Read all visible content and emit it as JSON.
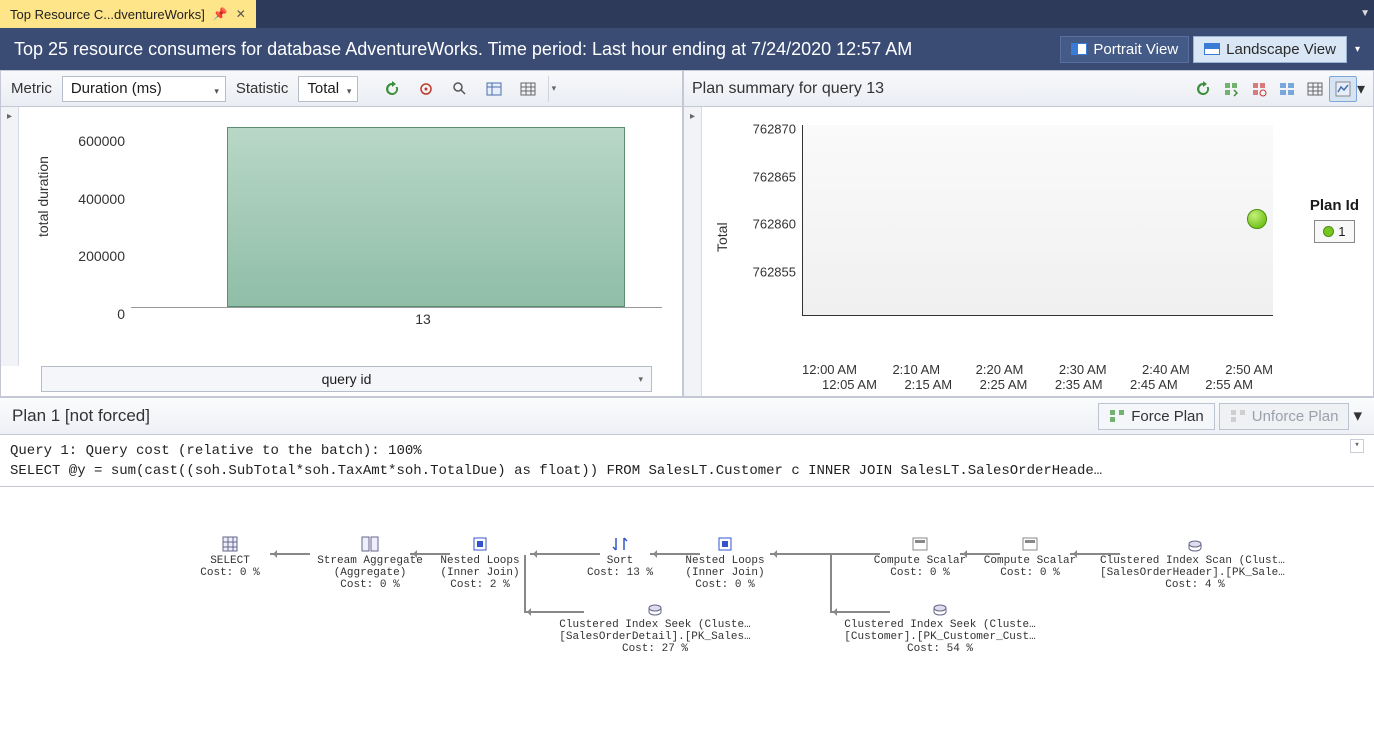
{
  "tab": {
    "title": "Top Resource C...dventureWorks]"
  },
  "header": {
    "title": "Top 25 resource consumers for database AdventureWorks. Time period: Last hour ending at 7/24/2020 12:57 AM",
    "portrait": "Portrait View",
    "landscape": "Landscape View"
  },
  "left_toolbar": {
    "metric_label": "Metric",
    "metric_value": "Duration (ms)",
    "statistic_label": "Statistic",
    "statistic_value": "Total"
  },
  "right_header": {
    "title": "Plan summary for query 13"
  },
  "left_chart": {
    "ylabel": "total duration",
    "yticks": [
      "600000",
      "400000",
      "200000",
      "0"
    ],
    "xitem": "13",
    "xlabel_dropdown": "query id"
  },
  "right_chart": {
    "ylabel": "Total",
    "yticks": [
      "762870",
      "762865",
      "762860",
      "762855"
    ],
    "xticks_top": [
      "12:00 AM",
      "2:10 AM",
      "2:20 AM",
      "2:30 AM",
      "2:40 AM",
      "2:50 AM"
    ],
    "xticks_bot": [
      "12:05 AM",
      "2:15 AM",
      "2:25 AM",
      "2:35 AM",
      "2:45 AM",
      "2:55 AM"
    ],
    "legend_title": "Plan Id",
    "legend_value": "1"
  },
  "plan_bar": {
    "title": "Plan 1 [not forced]",
    "force": "Force Plan",
    "unforce": "Unforce Plan"
  },
  "sql": {
    "line1": "Query 1: Query cost (relative to the batch): 100%",
    "line2": "SELECT @y = sum(cast((soh.SubTotal*soh.TaxAmt*soh.TotalDue) as float)) FROM SalesLT.Customer c INNER JOIN SalesLT.SalesOrderHeade…"
  },
  "ops": {
    "select": {
      "t1": "SELECT",
      "t2": "",
      "t3": "Cost: 0 %"
    },
    "agg": {
      "t1": "Stream Aggregate",
      "t2": "(Aggregate)",
      "t3": "Cost: 0 %"
    },
    "nl1": {
      "t1": "Nested Loops",
      "t2": "(Inner Join)",
      "t3": "Cost: 2 %"
    },
    "sort": {
      "t1": "Sort",
      "t2": "",
      "t3": "Cost: 13 %"
    },
    "nl2": {
      "t1": "Nested Loops",
      "t2": "(Inner Join)",
      "t3": "Cost: 0 %"
    },
    "cs1": {
      "t1": "Compute Scalar",
      "t2": "",
      "t3": "Cost: 0 %"
    },
    "cs2": {
      "t1": "Compute Scalar",
      "t2": "",
      "t3": "Cost: 0 %"
    },
    "cis": {
      "t1": "Clustered Index Scan (Cluste…",
      "t2": "[SalesOrderHeader].[PK_Sales…",
      "t3": "Cost: 4 %"
    },
    "seek1": {
      "t1": "Clustered Index Seek (Cluste…",
      "t2": "[SalesOrderDetail].[PK_Sales…",
      "t3": "Cost: 27 %"
    },
    "seek2": {
      "t1": "Clustered Index Seek (Cluste…",
      "t2": "[Customer].[PK_Customer_Cust…",
      "t3": "Cost: 54 %"
    }
  },
  "chart_data": [
    {
      "type": "bar",
      "title": "total duration by query id",
      "xlabel": "query id",
      "ylabel": "total duration",
      "categories": [
        "13"
      ],
      "values": [
        762860
      ],
      "ylim": [
        0,
        700000
      ]
    },
    {
      "type": "scatter",
      "title": "Plan summary for query 13",
      "ylabel": "Total",
      "ylim": [
        762850,
        762870
      ],
      "series": [
        {
          "name": "1",
          "points": [
            {
              "x": "2:55 AM",
              "y": 762860
            }
          ]
        }
      ],
      "x_categories": [
        "12:00 AM",
        "12:05 AM",
        "2:10 AM",
        "2:15 AM",
        "2:20 AM",
        "2:25 AM",
        "2:30 AM",
        "2:35 AM",
        "2:40 AM",
        "2:45 AM",
        "2:50 AM",
        "2:55 AM"
      ]
    }
  ]
}
